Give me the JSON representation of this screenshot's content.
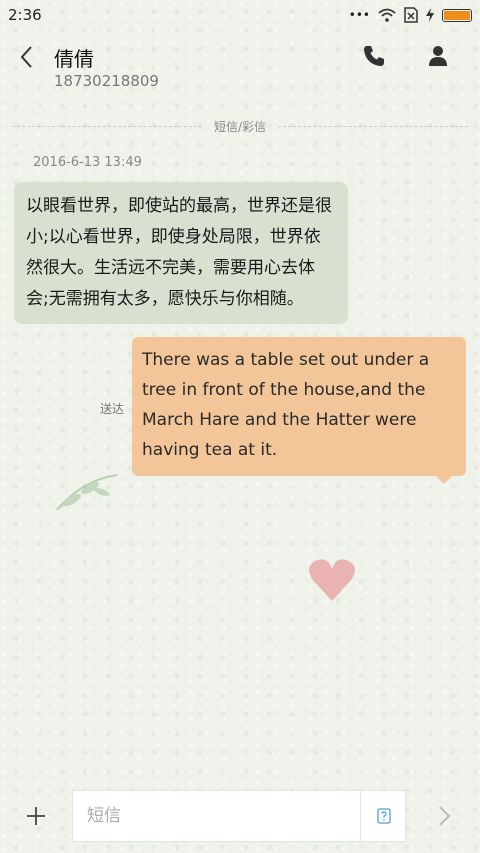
{
  "status_bar": {
    "time": "2:36",
    "dots": "•••"
  },
  "header": {
    "contact_name": "倩倩",
    "contact_number": "18730218809",
    "icons": [
      "back-arrow-icon",
      "phone-icon",
      "person-icon"
    ]
  },
  "divider": {
    "label": "短信/彩信"
  },
  "conversation": {
    "timestamp": "2016-6-13 13:49",
    "incoming_message": "以眼看世界，即使站的最高，世界还是很小;以心看世界，即使身处局限，世界依然很大。生活远不完美，需要用心去体会;无需拥有太多，愿快乐与你相随。",
    "outgoing_message": "There was a table set out under a tree in front of the house,and the March Hare and the Hatter were having tea at it.",
    "sent_status": "送达"
  },
  "input_bar": {
    "placeholder": "短信",
    "icons": [
      "plus-icon",
      "quick-reply-icon",
      "send-chevron-icon"
    ]
  },
  "colors": {
    "incoming_bubble": "#d6e0ce",
    "outgoing_bubble": "#f2c699",
    "battery": "#f08c1a"
  }
}
